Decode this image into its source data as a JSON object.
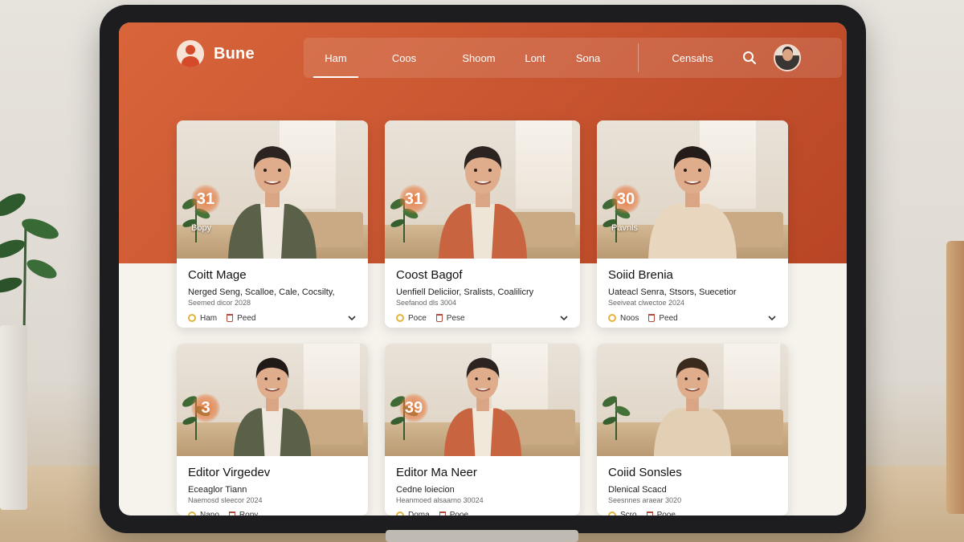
{
  "brand": {
    "name": "Bune"
  },
  "nav": {
    "items": [
      "Ham",
      "Coos",
      "Shoom",
      "Lont",
      "Sona"
    ],
    "active_index": 0,
    "right_label": "Censahs"
  },
  "cards": [
    {
      "badge": "31",
      "photo_caption": "Bopy",
      "title": "Coitt Mage",
      "subtitle": "Nerged Seng, Scalloe, Cale, Cocsilty,",
      "meta": "Seemed dicor 2028",
      "action1": "Ham",
      "action2": "Peed",
      "shirt": "#5b6148",
      "top": "#efe9df",
      "hair": "#2b2420"
    },
    {
      "badge": "31",
      "photo_caption": "",
      "title": "Coost Bagof",
      "subtitle": "Uenfiell Deliciior, Sralists, Coalilicry",
      "meta": "Seefanod dls 3004",
      "action1": "Poce",
      "action2": "Pese",
      "shirt": "#c8643f",
      "top": "#efe5d6",
      "hair": "#2b2420"
    },
    {
      "badge": "30",
      "photo_caption": "Pavnls",
      "title": "Soiid Brenia",
      "subtitle": "Uateacl Senra, Stsors, Suecetior",
      "meta": "Seeiveat clwectoe 2024",
      "action1": "Noos",
      "action2": "Peed",
      "shirt": "#e8d6bf",
      "top": "#e8d6bf",
      "hair": "#231c18"
    },
    {
      "badge": "3",
      "photo_caption": "",
      "title": "Editor Virgedev",
      "subtitle": "Eceaglor Tiann",
      "meta": "Naemosd sleecor 2024",
      "action1": "Nano",
      "action2": "Ropy",
      "shirt": "#5b6148",
      "top": "#efe9df",
      "hair": "#1f1a17"
    },
    {
      "badge": "39",
      "photo_caption": "",
      "title": "Editor Ma Neer",
      "subtitle": "Cedne loiecion",
      "meta": "Heanmoed alsaarno 30024",
      "action1": "Doma",
      "action2": "Pooe",
      "shirt": "#c8643f",
      "top": "#f1e8da",
      "hair": "#2b2420"
    },
    {
      "badge": "",
      "photo_caption": "",
      "title": "Coiid Sonsles",
      "subtitle": "Dlenical Scacd",
      "meta": "Seesnnes araear 3020",
      "action1": "Scro",
      "action2": "Pooe",
      "shirt": "#e3cfb4",
      "top": "#e3cfb4",
      "hair": "#3a2a1e"
    }
  ],
  "colors": {
    "brand_orange": "#d45a34",
    "card_bg": "#ffffff",
    "page_bg": "#f6f2ec"
  },
  "icons": [
    "user-logo-icon",
    "search-icon",
    "avatar-icon",
    "badge-icon",
    "trash-icon",
    "chevron-down-icon"
  ]
}
